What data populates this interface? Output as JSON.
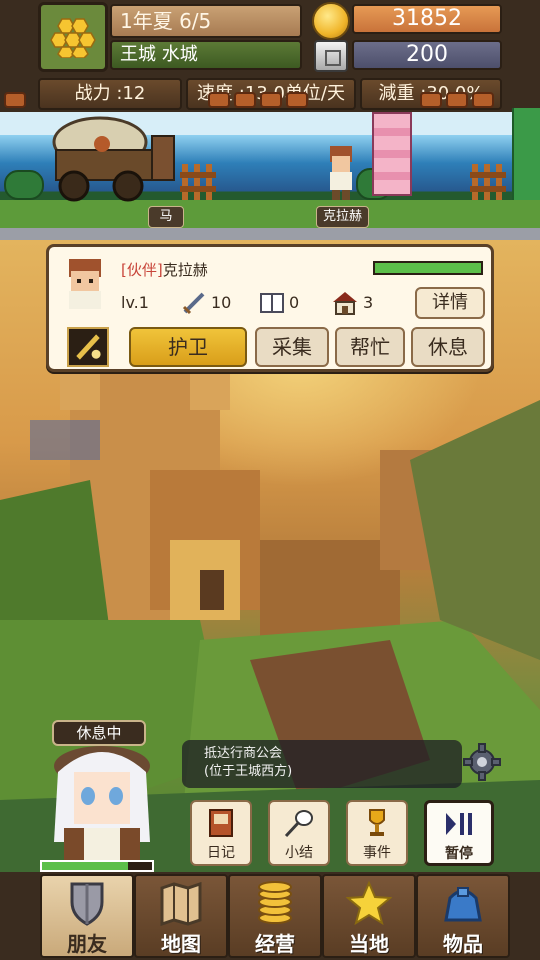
{
  "hud": {
    "date": "1年夏 6/5",
    "location": "王城 水城",
    "gold": "31852",
    "gems": "200",
    "power": "战力 :12",
    "speed": "速度 :13.0单位/天",
    "weight": "減重 :30.0%",
    "season_icon": "honeycomb-icon"
  },
  "road": {
    "horse_label": "马",
    "npc_label": "克拉赫"
  },
  "companion": {
    "tag": "[伙伴]",
    "name": "克拉赫",
    "hp_fraction": 1.0,
    "level": "lv.1",
    "attack": "10",
    "books": "0",
    "houses": "3",
    "detail_button": "详情",
    "actions": [
      "护卫",
      "采集",
      "帮忙",
      "休息"
    ],
    "active_action": "护卫"
  },
  "player": {
    "status": "休息中",
    "hp_fraction": 0.78
  },
  "message": {
    "line1": "抵达行商公会",
    "line2": "(位于王城西方)"
  },
  "menu": {
    "diary": "日记",
    "summary": "小结",
    "event": "事件",
    "pause": "暂停"
  },
  "nav": {
    "friends": "朋友",
    "map": "地图",
    "business": "经营",
    "local": "当地",
    "items": "物品",
    "active": "朋友"
  },
  "colors": {
    "accent_gold": "#f0c43a",
    "hp_green": "#5cbf4a",
    "panel_brown": "#3a2c1f",
    "tag_red": "#c8453a"
  }
}
